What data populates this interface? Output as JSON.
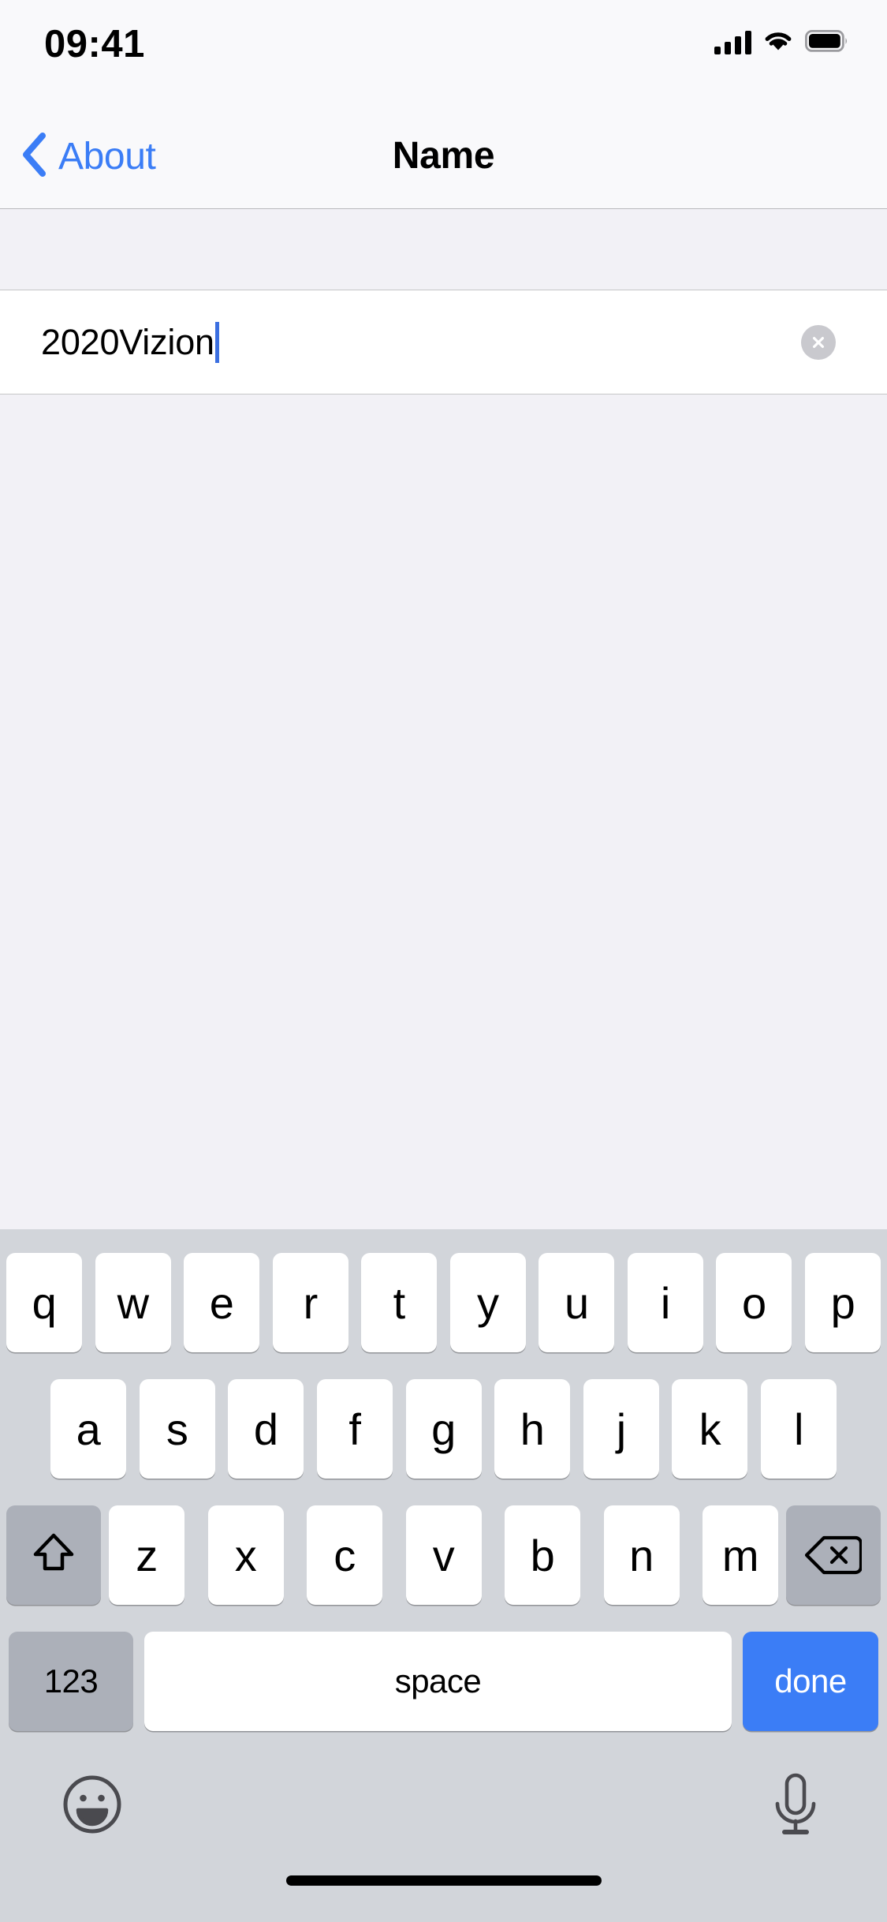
{
  "status_bar": {
    "time": "09:41",
    "signal_icon": "cellular-signal-icon",
    "wifi_icon": "wifi-icon",
    "battery_icon": "battery-full-icon"
  },
  "nav_bar": {
    "back_label": "About",
    "back_icon": "chevron-left-icon",
    "title": "Name",
    "accent_color": "#3b7df6"
  },
  "name_field": {
    "value": "2020Vizion",
    "placeholder": "Name",
    "clear_icon": "clear-circle-x-icon",
    "caret_color": "#3b6fe0"
  },
  "keyboard": {
    "row1": [
      "q",
      "w",
      "e",
      "r",
      "t",
      "y",
      "u",
      "i",
      "o",
      "p"
    ],
    "row2": [
      "a",
      "s",
      "d",
      "f",
      "g",
      "h",
      "j",
      "k",
      "l"
    ],
    "row3": [
      "z",
      "x",
      "c",
      "v",
      "b",
      "n",
      "m"
    ],
    "shift_icon": "shift-arrow-up-icon",
    "delete_icon": "delete-backward-icon",
    "numbers_label": "123",
    "space_label": "space",
    "done_label": "done",
    "done_color": "#3b7df6",
    "emoji_icon": "emoji-smiley-icon",
    "mic_icon": "microphone-icon",
    "background_color": "#d2d5da",
    "special_key_color": "#acb0b9"
  },
  "home_indicator": "home-indicator-bar"
}
